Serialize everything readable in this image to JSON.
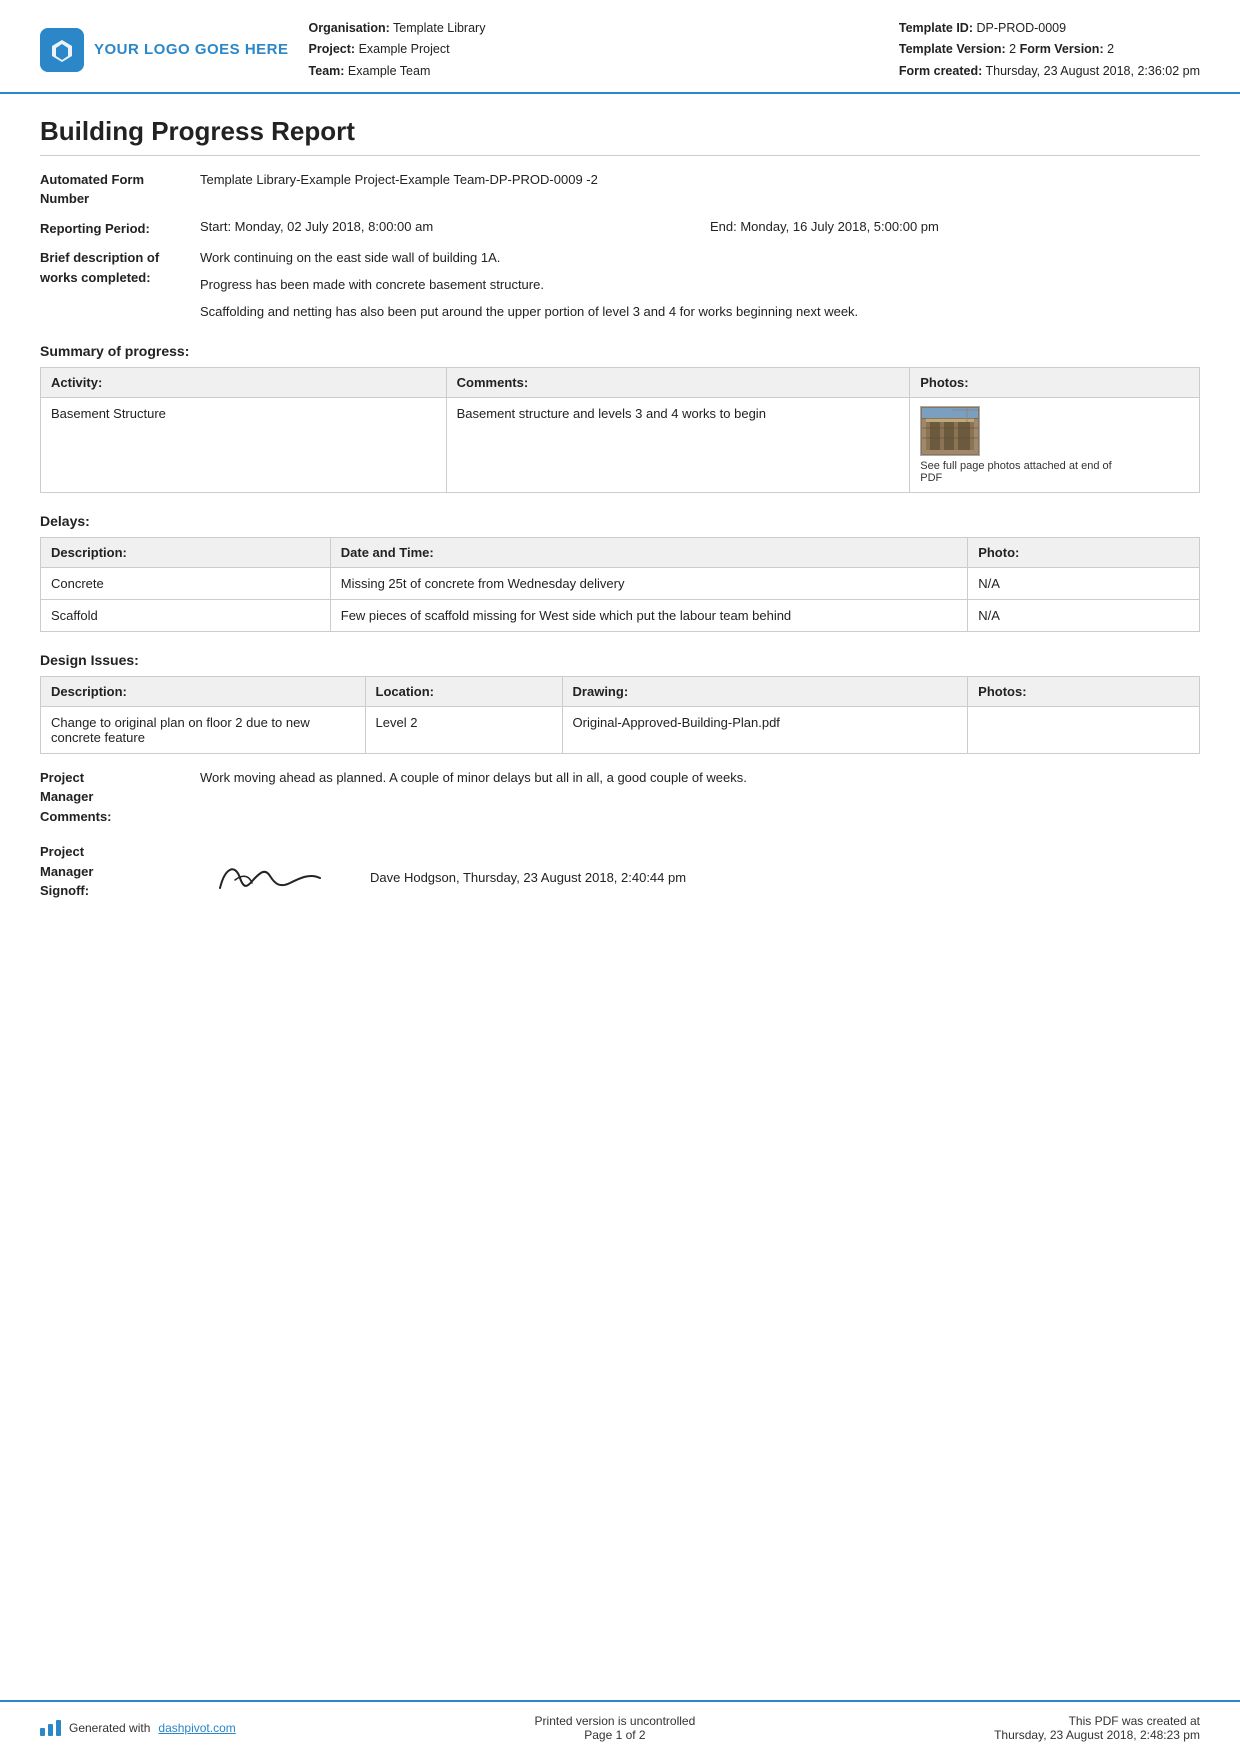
{
  "header": {
    "logo_text": "YOUR LOGO GOES HERE",
    "org_label": "Organisation:",
    "org_value": "Template Library",
    "project_label": "Project:",
    "project_value": "Example Project",
    "team_label": "Team:",
    "team_value": "Example Team",
    "template_id_label": "Template ID:",
    "template_id_value": "DP-PROD-0009",
    "template_version_label": "Template Version:",
    "template_version_value": "2",
    "form_version_label": "Form Version:",
    "form_version_value": "2",
    "form_created_label": "Form created:",
    "form_created_value": "Thursday, 23 August 2018, 2:36:02 pm"
  },
  "report": {
    "title": "Building Progress Report",
    "form_number_label": "Automated Form Number",
    "form_number_value": "Template Library-Example Project-Example Team-DP-PROD-0009   -2",
    "reporting_period_label": "Reporting Period:",
    "reporting_start": "Start: Monday, 02 July 2018, 8:00:00 am",
    "reporting_end": "End: Monday, 16 July 2018, 5:00:00 pm",
    "brief_desc_label": "Brief description of works completed:",
    "brief_desc_lines": [
      "Work continuing on the east side wall of building 1A.",
      "Progress has been made with concrete basement structure.",
      "Scaffolding and netting has also been put around the upper portion of level 3 and 4 for works beginning next week."
    ]
  },
  "summary_section": {
    "title": "Summary of progress:",
    "table": {
      "headers": [
        "Activity:",
        "Comments:",
        "Photos:"
      ],
      "rows": [
        {
          "activity": "Basement Structure",
          "comments": "Basement structure and levels 3 and 4 works to begin",
          "has_photo": true,
          "photo_caption": "See full page photos attached at end of PDF"
        }
      ]
    }
  },
  "delays_section": {
    "title": "Delays:",
    "table": {
      "headers": [
        "Description:",
        "Date and Time:",
        "Photo:"
      ],
      "rows": [
        {
          "description": "Concrete",
          "date_time": "Missing 25t of concrete from Wednesday delivery",
          "photo": "N/A"
        },
        {
          "description": "Scaffold",
          "date_time": "Few pieces of scaffold missing for West side which put the labour team behind",
          "photo": "N/A"
        }
      ]
    }
  },
  "design_issues_section": {
    "title": "Design Issues:",
    "table": {
      "headers": [
        "Description:",
        "Location:",
        "Drawing:",
        "Photos:"
      ],
      "rows": [
        {
          "description": "Change to original plan on floor 2 due to new concrete feature",
          "location": "Level 2",
          "drawing": "Original-Approved-Building-Plan.pdf",
          "photo": ""
        }
      ]
    }
  },
  "pm_comments": {
    "label": "Project Manager Comments:",
    "value": "Work moving ahead as planned. A couple of minor delays but all in all, a good couple of weeks."
  },
  "pm_signoff": {
    "label": "Project Manager Signoff:",
    "name": "Dave Hodgson, Thursday, 23 August 2018, 2:40:44 pm"
  },
  "footer": {
    "generated_text": "Generated with ",
    "generated_link": "dashpivot.com",
    "center_text": "Printed version is uncontrolled",
    "page_text": "Page 1 of 2",
    "right_text": "This PDF was created at",
    "right_date": "Thursday, 23 August 2018, 2:48:23 pm"
  }
}
